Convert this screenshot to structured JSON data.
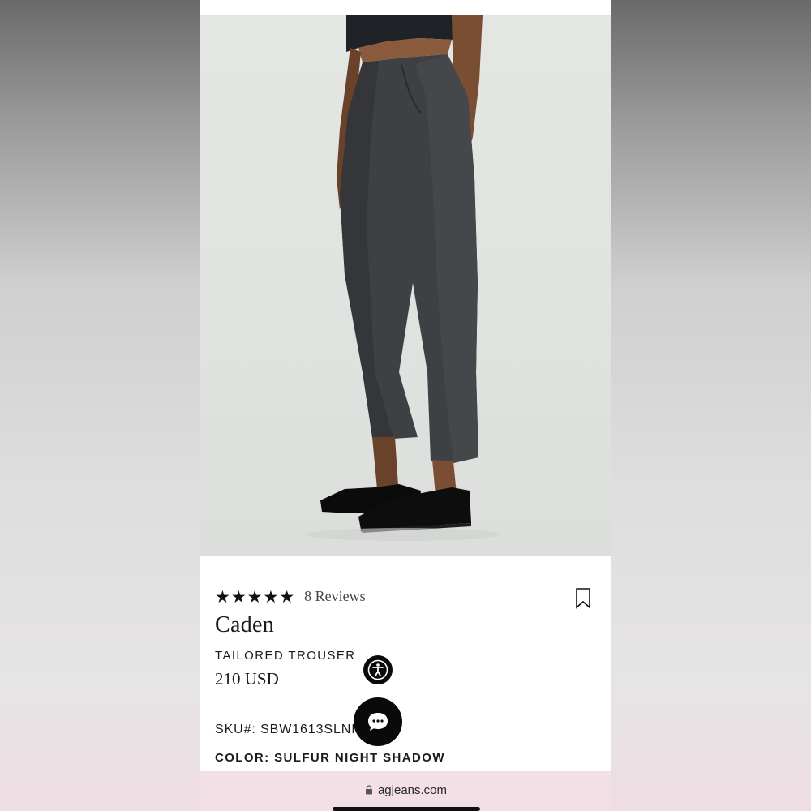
{
  "product": {
    "rating_stars": 5,
    "reviews_label": "8 Reviews",
    "name": "Caden",
    "category": "TAILORED TROUSER",
    "price": "210 USD",
    "sku": "SKU#: SBW1613SLNISH",
    "color": "COLOR: SULFUR NIGHT SHADOW"
  },
  "icons": {
    "star": "star-icon",
    "bookmark": "bookmark-icon",
    "accessibility": "accessibility-icon",
    "chat": "chat-icon",
    "lock": "lock-icon"
  },
  "browser": {
    "url": "agjeans.com"
  },
  "colors": {
    "accent": "#0a0a0a",
    "url_bar_bg": "#f3e0e6"
  }
}
